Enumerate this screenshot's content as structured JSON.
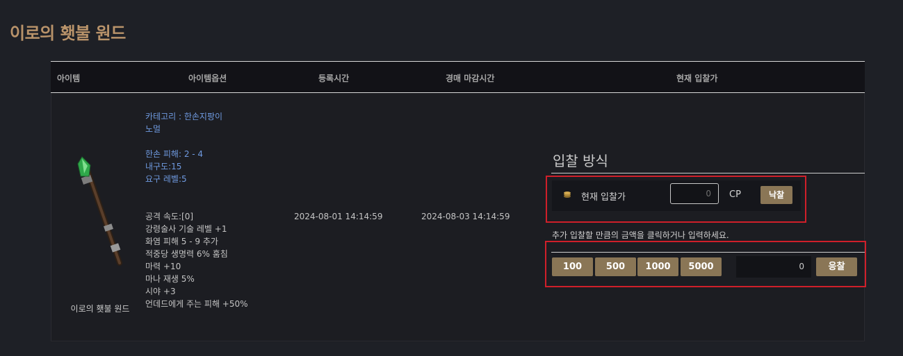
{
  "page": {
    "title": "이로의 횃불 원드"
  },
  "table": {
    "headers": {
      "item": "아이템",
      "options": "아이템옵션",
      "registered": "등록시간",
      "deadline": "경매 마감시간",
      "current_bid": "현재 입찰가"
    },
    "row": {
      "item_name": "이로의 횃불 원드",
      "item_icon": "green-tipped-wand-icon",
      "options_blue": {
        "category": "카테고리 : 한손지팡이",
        "grade": "노멀",
        "damage": "한손 피해: 2 - 4",
        "durability": "내구도:15",
        "req_level": "요구 레벨:5"
      },
      "options_gray": [
        "공격 속도:[0]",
        "강령술사 기술 레벨 +1",
        "화염 피해 5 - 9 추가",
        "적중당 생명력 6% 훔침",
        "마력 +10",
        "마나 재생 5%",
        "시야 +3",
        "언데드에게 주는 피해 +50%"
      ],
      "registered_time": "2024-08-01 14:14:59",
      "deadline_time": "2024-08-03 14:14:59"
    }
  },
  "bid": {
    "section_title": "입찰 방식",
    "current_label": "현재 입찰가",
    "current_value": "0",
    "currency": "CP",
    "win_button": "낙찰",
    "hint": "추가 입찰할 만큼의 금액을 클릭하거나 입력하세요.",
    "amounts": [
      "100",
      "500",
      "1000",
      "5000"
    ],
    "input_value": "0",
    "submit_button": "응찰"
  },
  "colors": {
    "background": "#1e2026",
    "title": "#b9936a",
    "button": "#8a7656",
    "option_blue": "#6f9ae0",
    "highlight_red": "#d01f2a"
  }
}
